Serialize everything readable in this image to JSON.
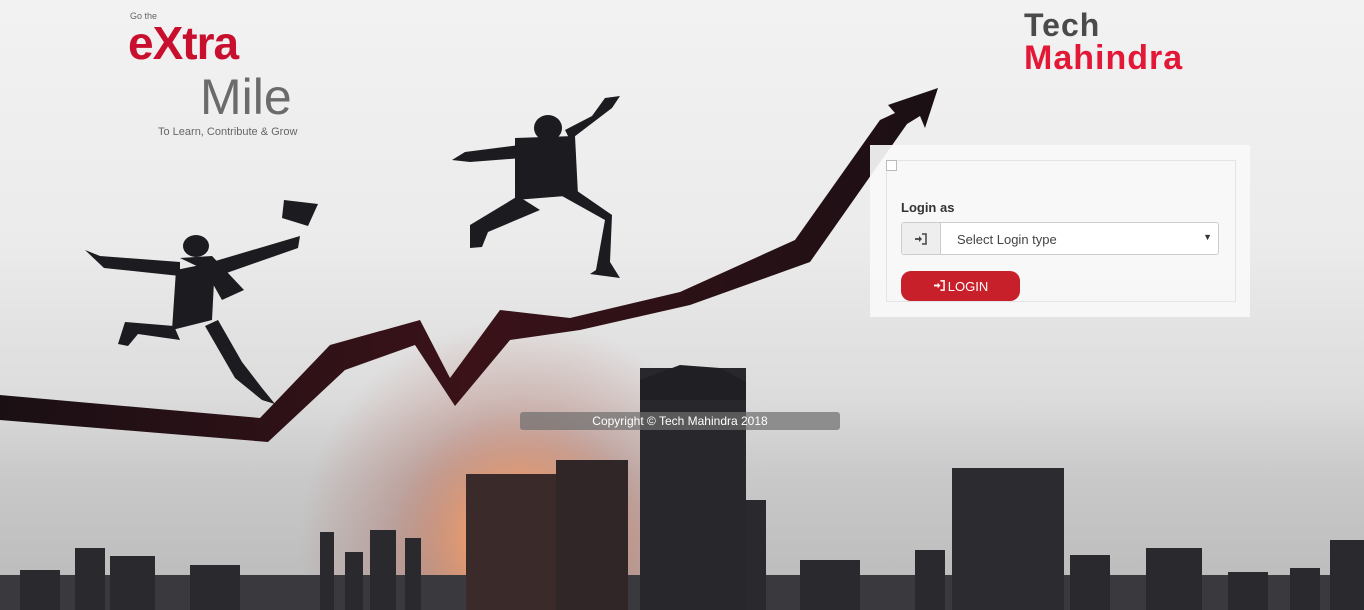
{
  "branding": {
    "extra_mile": {
      "go_the": "Go the",
      "extra": "eXtra",
      "mile": "Mile",
      "tagline": "To Learn, Contribute & Grow"
    },
    "company": {
      "line1": "Tech",
      "line2": "Mahindra"
    }
  },
  "login": {
    "label": "Login as",
    "select": {
      "selected": "Select Login type",
      "options": [
        "Select Login type"
      ]
    },
    "button_label": "LOGIN",
    "icons": [
      "sign-in-icon",
      "chevron-down-icon"
    ]
  },
  "footer": {
    "copyright": "Copyright © Tech Mahindra 2018"
  },
  "colors": {
    "brand_red": "#c8102e",
    "button_red": "#c8202a",
    "logo_grey": "#6b6b6b"
  }
}
